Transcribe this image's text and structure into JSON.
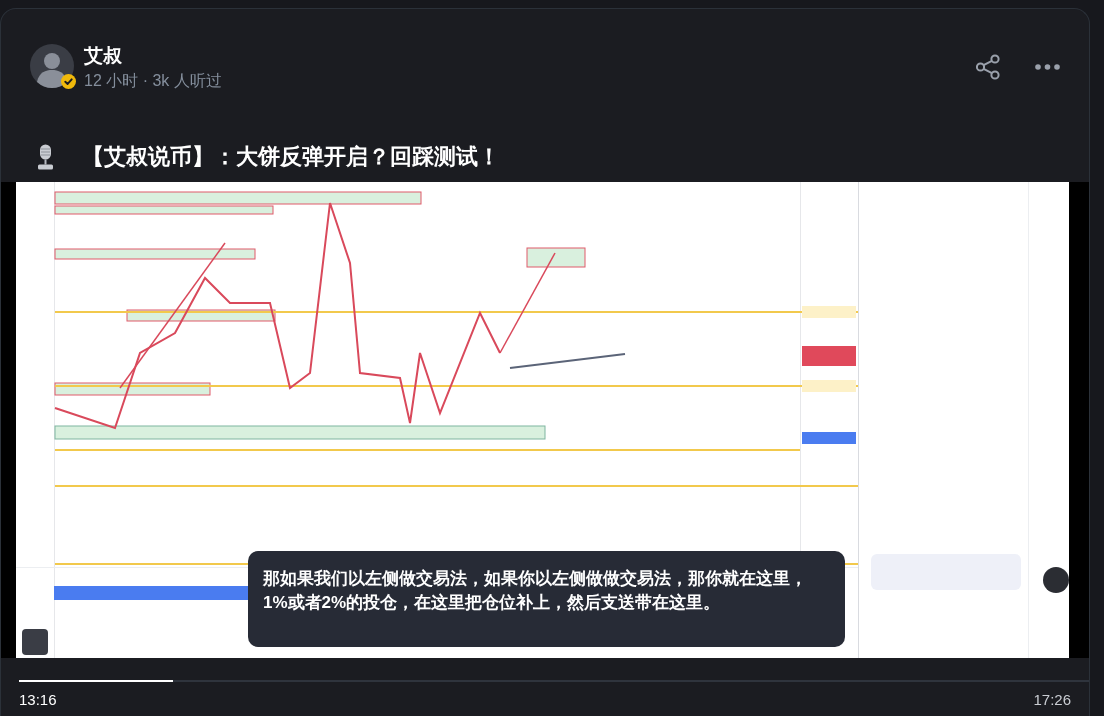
{
  "post": {
    "author": "艾叔",
    "verified": true,
    "meta": "12 小时 · 3k 人听过",
    "title": "【艾叔说币】：大饼反弹开启？回踩测试！"
  },
  "video": {
    "subtitle": "那如果我们以左侧做交易法，如果你以左侧做做交易法，那你就在这里，1%或者2%的投仓，在这里把仓位补上，然后支送带在这里。",
    "progress": {
      "level": 0.144
    },
    "current_time": "13:16",
    "duration": "17:26"
  }
}
